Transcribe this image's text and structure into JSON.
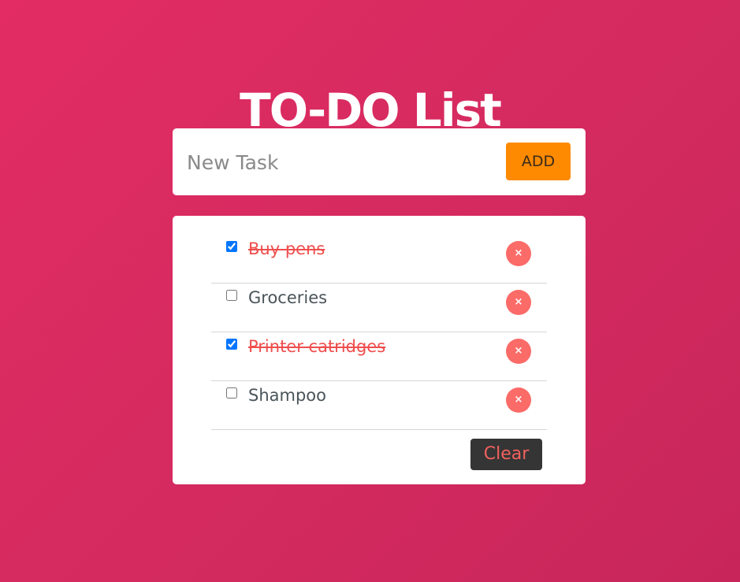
{
  "app": {
    "title": "TO-DO List"
  },
  "new_task": {
    "placeholder": "New Task",
    "value": "",
    "add_label": "ADD"
  },
  "tasks": [
    {
      "label": "Buy pens",
      "done": true,
      "remove_icon": "×"
    },
    {
      "label": "Groceries",
      "done": false,
      "remove_icon": "×"
    },
    {
      "label": "Printer catridges",
      "done": true,
      "remove_icon": "×"
    },
    {
      "label": "Shampoo",
      "done": false,
      "remove_icon": "×"
    }
  ],
  "footer": {
    "clear_label": "Clear"
  },
  "colors": {
    "background_start": "#e22c63",
    "background_end": "#c8265b",
    "add_button": "#fd8a00",
    "delete_button": "#fb6b68",
    "done_text": "#ef4e4e",
    "clear_button": "#353535"
  },
  "icons": {
    "remove": "close-icon"
  }
}
